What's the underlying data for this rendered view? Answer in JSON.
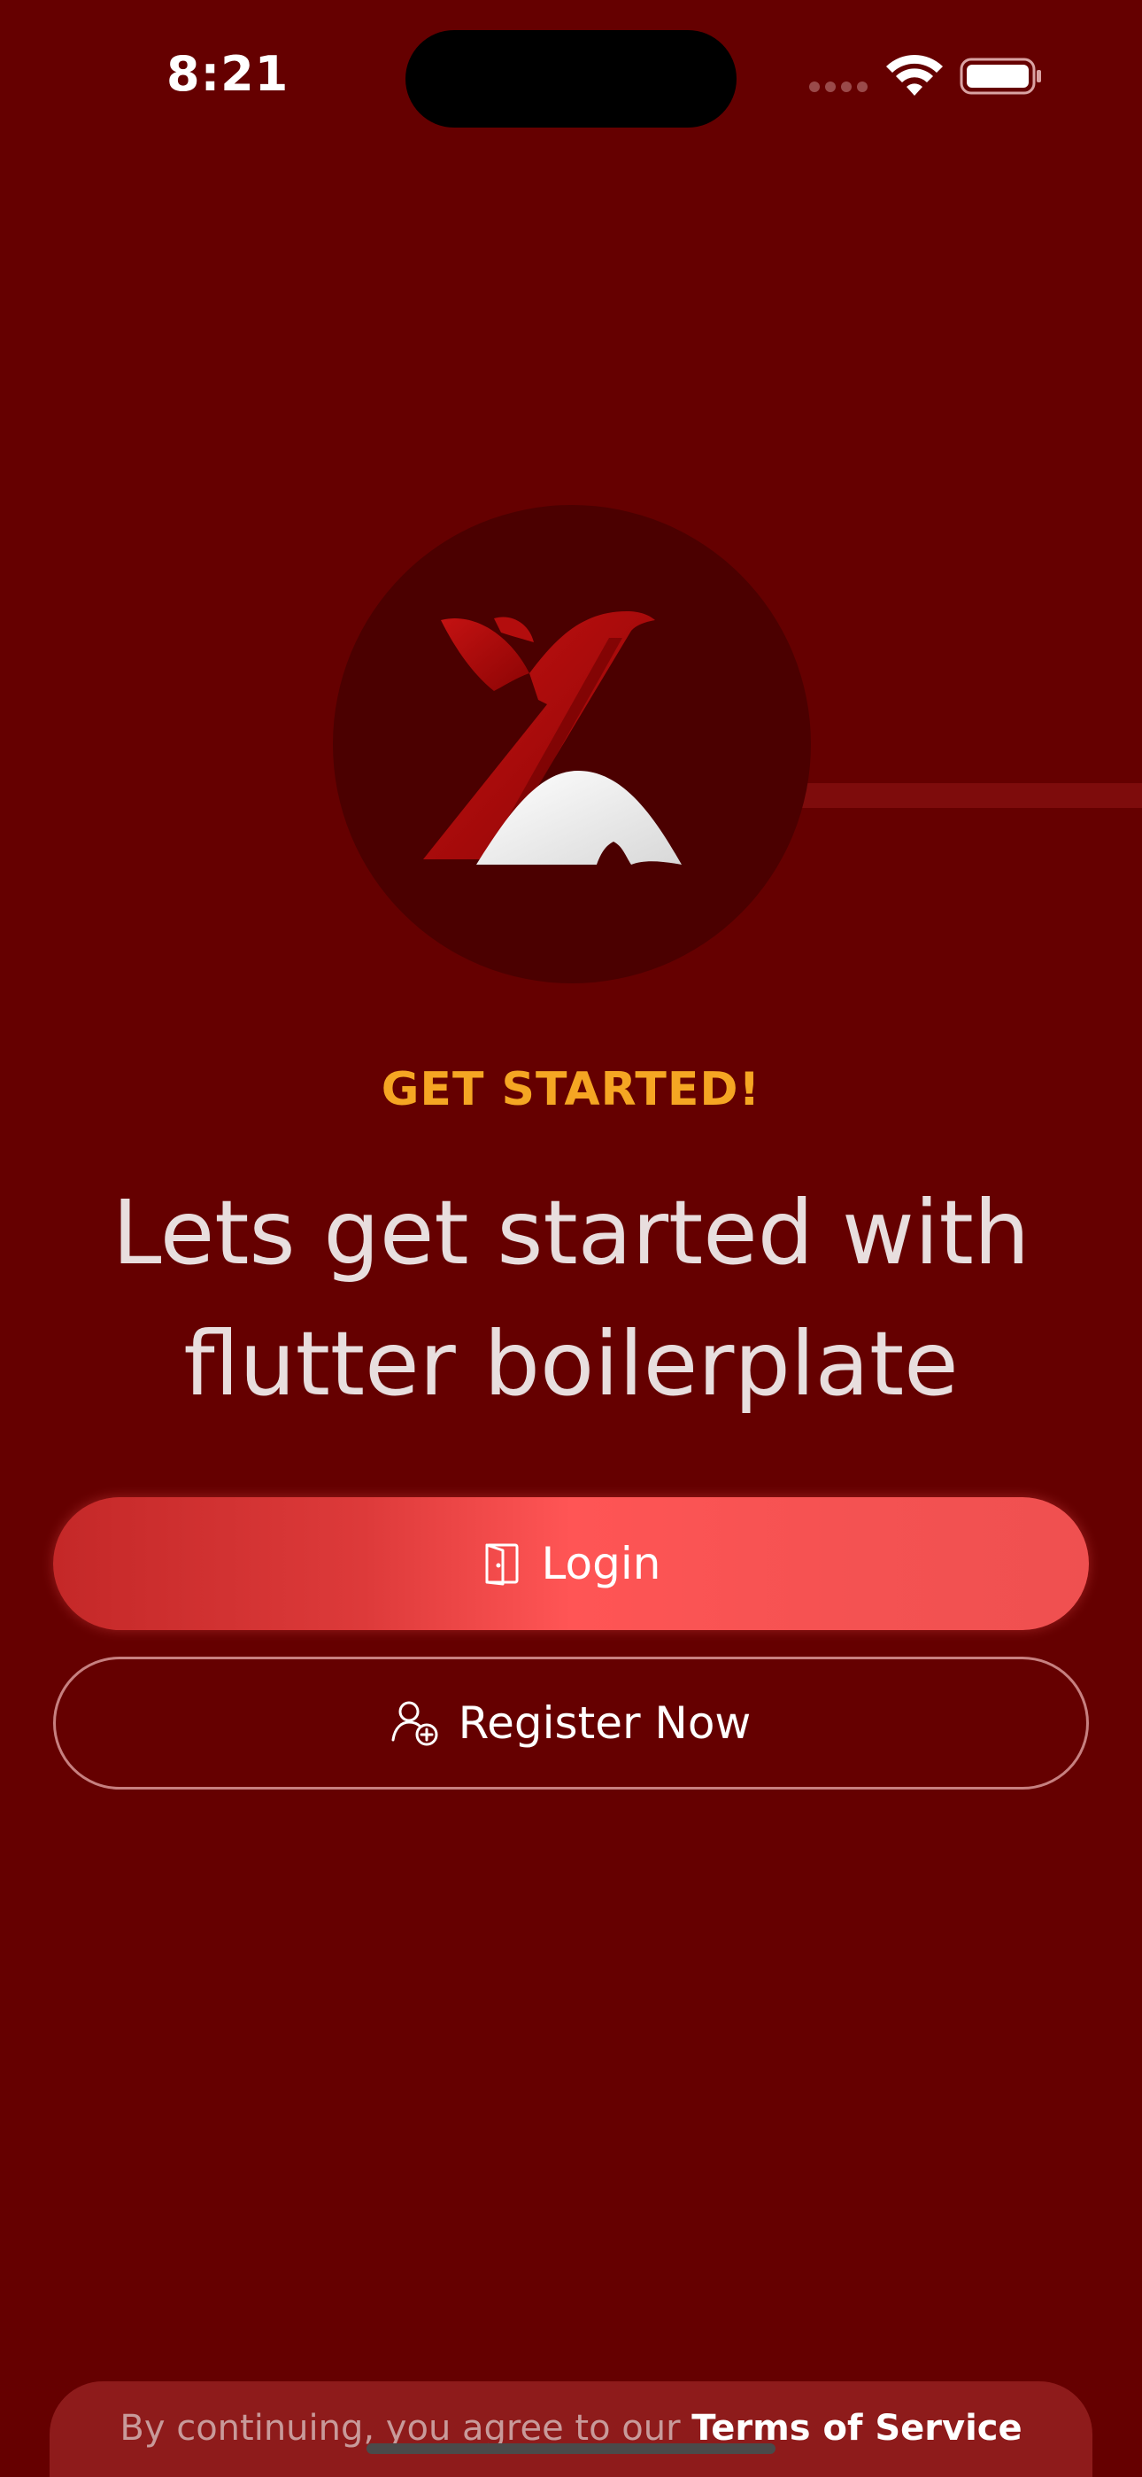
{
  "status_bar": {
    "time": "8:21",
    "signal_icon": "cellular-signal-icon",
    "wifi_icon": "wifi-icon",
    "battery_icon": "battery-icon"
  },
  "logo": {
    "icon": "brand-logo-icon"
  },
  "onboarding": {
    "eyebrow": "GET STARTED!",
    "headline_line1": "Lets get started with",
    "headline_line2": "flutter boilerplate"
  },
  "buttons": {
    "login_label": "Login",
    "login_icon": "door-icon",
    "register_label": "Register Now",
    "register_icon": "add-user-icon"
  },
  "footer": {
    "prefix": "By continuing, you agree to our ",
    "terms_link": "Terms of Service"
  },
  "colors": {
    "background": "#650000",
    "accent": "#f5a623",
    "button_primary": "#ff5555"
  }
}
